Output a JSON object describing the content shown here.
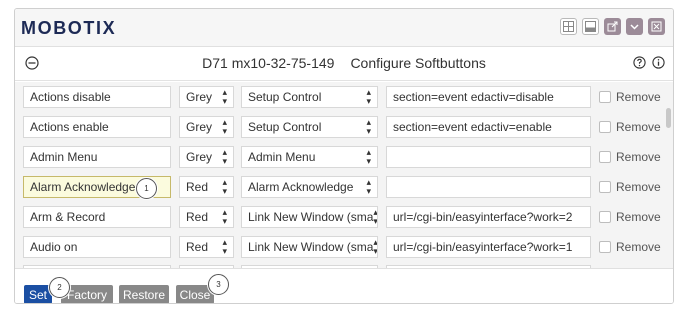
{
  "header": {
    "logo": "MOBOTIX",
    "window_icons": [
      "grid-icon",
      "window-icon",
      "popout-icon",
      "minimize-icon",
      "close-icon"
    ]
  },
  "subheader": {
    "camera_name": "D71 mx10-32-75-149",
    "dialog_title": "Configure Softbuttons",
    "icons": [
      "collapse-icon",
      "help-icon",
      "info-icon"
    ]
  },
  "rows": [
    {
      "name": "Actions disable",
      "color": "Grey",
      "action": "Setup Control",
      "parameter": "section=event edactiv=disable",
      "remove_label": "Remove"
    },
    {
      "name": "Actions enable",
      "color": "Grey",
      "action": "Setup Control",
      "parameter": "section=event edactiv=enable",
      "remove_label": "Remove"
    },
    {
      "name": "Admin Menu",
      "color": "Grey",
      "action": "Admin Menu",
      "parameter": "",
      "remove_label": "Remove"
    },
    {
      "name": "Alarm Acknowledge",
      "color": "Red",
      "action": "Alarm Acknowledge",
      "parameter": "",
      "remove_label": "Remove"
    },
    {
      "name": "Arm & Record",
      "color": "Red",
      "action": "Link New Window (sma",
      "parameter": "url=/cgi-bin/easyinterface?work=2",
      "remove_label": "Remove"
    },
    {
      "name": "Audio on",
      "color": "Red",
      "action": "Link New Window (sma",
      "parameter": "url=/cgi-bin/easyinterface?work=1",
      "remove_label": "Remove"
    }
  ],
  "footer": {
    "set_label": "Set",
    "factory_label": "Factory",
    "restore_label": "Restore",
    "close_label": "Close"
  },
  "callouts": {
    "one": "1",
    "two": "2",
    "three": "3"
  },
  "colors": {
    "logo": "#1d2a55",
    "set_button": "#1b4fa3",
    "secondary_button": "#888888"
  }
}
